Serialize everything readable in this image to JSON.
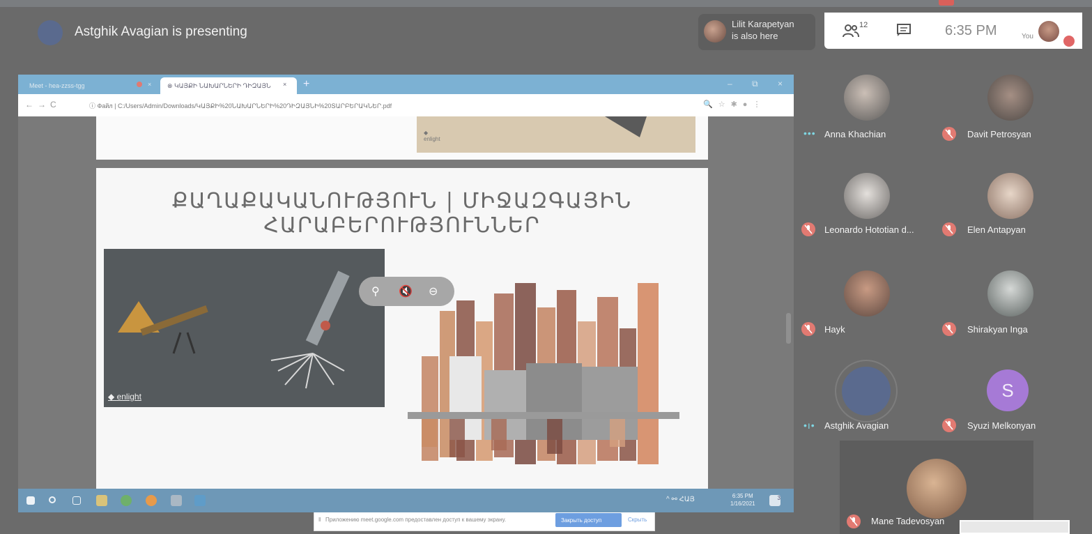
{
  "meeting": {
    "presenter_text": "Astghik Avagian is presenting",
    "also_here_name": "Lilit Karapetyan",
    "also_here_suffix": "is also here",
    "participant_count": "12",
    "time": "6:35 PM",
    "you_label": "You"
  },
  "browser": {
    "tab1_label": "Meet - hea-zzss-tgg",
    "tab2_label": "ԿԱՅՔԻ ՆԱԽԱՐՆԵՐԻ ԴԻԶԱՅՆ",
    "url_prefix": "Файл",
    "url": "C:/Users/Admin/Downloads/ԿԱՅՔԻ%20ՆԱԽԱՐՆԵՐԻ%20ԴԻԶԱՅՆԻ%20ՏԱՐԲԵՐԱԿՆԵՐ.pdf"
  },
  "slides": {
    "slide1_logo": "enlight",
    "slide2_title": "ՔԱՂԱՔԱԿԱՆՈՒԹՅՈՒՆ | ՄԻՋԱԶԳԱՅԻՆ ՀԱՐԱԲԵՐՈՒԹՅՈՒՆՆԵՐ",
    "enlight_logo": "enlight"
  },
  "share_bar": {
    "message": "Приложению meet.google.com предоставлен доступ к вашему экрану.",
    "stop_label": "Закрыть доступ",
    "hide_label": "Скрыть"
  },
  "taskbar": {
    "lang": "ՀԱՅ",
    "time": "6:35 PM",
    "date": "1/16/2021",
    "notif_count": "3"
  },
  "participants": [
    {
      "name": "Anna Khachian",
      "status": "speaking-dots"
    },
    {
      "name": "Davit Petrosyan",
      "status": "muted"
    },
    {
      "name": "Leonardo Hototian d...",
      "status": "muted"
    },
    {
      "name": "Elen Antapyan",
      "status": "muted"
    },
    {
      "name": "Hayk",
      "status": "muted"
    },
    {
      "name": "Shirakyan Inga",
      "status": "muted"
    },
    {
      "name": "Astghik Avagian",
      "status": "speaking"
    },
    {
      "name": "Syuzi Melkonyan",
      "status": "muted",
      "initial": "S"
    },
    {
      "name": "Mane Tadevosyan",
      "status": "muted"
    }
  ],
  "colors": {
    "mute_red": "#e27a72",
    "accent_blue": "#7cb1d3",
    "syuzi_purple": "#a67ad6"
  }
}
